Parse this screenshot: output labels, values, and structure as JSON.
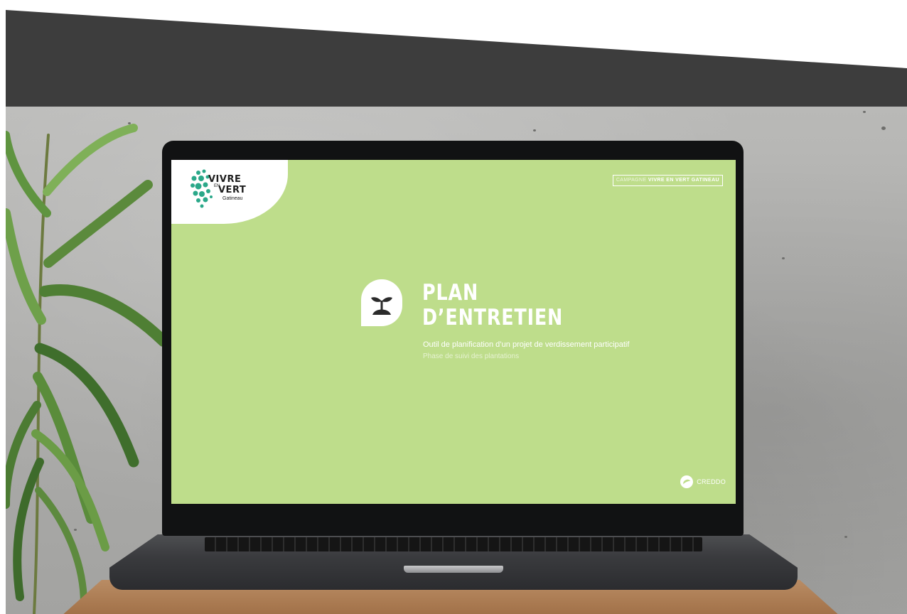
{
  "screen": {
    "logo": {
      "line1": "VIVRE",
      "line2": "EN",
      "line3": "VERT",
      "city": "Gatineau"
    },
    "campaign": {
      "prefix": "CAMPAGNE",
      "name": "VIVRE EN VERT GATINEAU"
    },
    "title_line1": "PLAN",
    "title_line2": "D’ENTRETIEN",
    "subtitle": "Outil de planification d’un projet de verdissement participatif",
    "phase": "Phase de suivi des plantations",
    "footer_brand": "CREDDO",
    "icon": "seedling-icon",
    "colors": {
      "screen_bg": "#bedd8b",
      "top_band": "#3d3d3d",
      "logo_dots": "#2aa889"
    }
  }
}
